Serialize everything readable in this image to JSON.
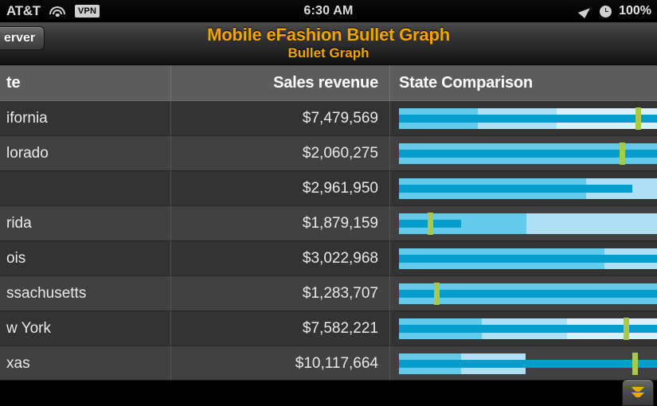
{
  "status_bar": {
    "carrier": "AT&T",
    "wifi_icon": "wifi-icon",
    "vpn_badge": "VPN",
    "time": "6:30 AM",
    "location_icon": "location-arrow-icon",
    "alarm_icon": "alarm-clock-icon",
    "battery": "100%"
  },
  "navbar": {
    "back_button_label": "erver",
    "title": "Mobile eFashion Bullet Graph",
    "subtitle": "Bullet Graph"
  },
  "table": {
    "headers": {
      "state": "te",
      "revenue": "Sales revenue",
      "comparison": "State Comparison"
    },
    "rows": [
      {
        "state": "ifornia",
        "revenue": "$7,479,569"
      },
      {
        "state": "lorado",
        "revenue": "$2,060,275"
      },
      {
        "state": "",
        "revenue": "$2,961,950"
      },
      {
        "state": "rida",
        "revenue": "$1,879,159"
      },
      {
        "state": "ois",
        "revenue": "$3,022,968"
      },
      {
        "state": "ssachusetts",
        "revenue": "$1,283,707"
      },
      {
        "state": "w York",
        "revenue": "$7,582,221"
      },
      {
        "state": "xas",
        "revenue": "$10,117,664"
      }
    ]
  },
  "chart_data": {
    "type": "bar",
    "title": "Mobile eFashion Bullet Graph",
    "subtitle": "Bullet Graph",
    "xlabel": "",
    "ylabel": "Sales revenue",
    "categories": [
      "ifornia",
      "lorado",
      "",
      "rida",
      "ois",
      "ssachusetts",
      "w York",
      "xas"
    ],
    "values": [
      7479569,
      2060275,
      2961950,
      1879159,
      3022968,
      1283707,
      7582221,
      10117664
    ],
    "value_labels": [
      "$7,479,569",
      "$2,060,275",
      "$2,961,950",
      "$1,879,159",
      "$3,022,968",
      "$1,283,707",
      "$7,582,221",
      "$10,117,664"
    ],
    "colors": {
      "value_bar": "#089CCB",
      "band_1": "#62CBEA",
      "band_2": "#AEDFF3",
      "band_3": "#DCEFF9",
      "target_marker": "#A9C84C",
      "row_odd": "#333333",
      "row_even": "#414141",
      "header": "#5C5C5C",
      "accent": "#F0A500"
    },
    "bullets": [
      {
        "bar_pct": 100.0,
        "marker_pct": 92.5,
        "bands": [
          30.5,
          61.0,
          100.0
        ]
      },
      {
        "bar_pct": 100.0,
        "marker_pct": 86.5,
        "bands": [
          100.0
        ]
      },
      {
        "bar_pct": 90.5,
        "marker_pct": null,
        "bands": [
          72.5,
          100.0
        ]
      },
      {
        "bar_pct": 24.0,
        "marker_pct": 12.0,
        "bands": [
          49.5,
          100.0
        ]
      },
      {
        "bar_pct": 100.0,
        "marker_pct": null,
        "bands": [
          79.5,
          100.0
        ]
      },
      {
        "bar_pct": 100.0,
        "marker_pct": 14.5,
        "bands": [
          100.0
        ]
      },
      {
        "bar_pct": 100.0,
        "marker_pct": 88.0,
        "bands": [
          32.0,
          65.0,
          100.0
        ]
      },
      {
        "bar_pct": 100.0,
        "marker_pct": 91.5,
        "bands": [
          24.0,
          49.0
        ]
      }
    ]
  },
  "bottom_bar": {
    "expand_button_icon": "chevron-up-icon"
  }
}
